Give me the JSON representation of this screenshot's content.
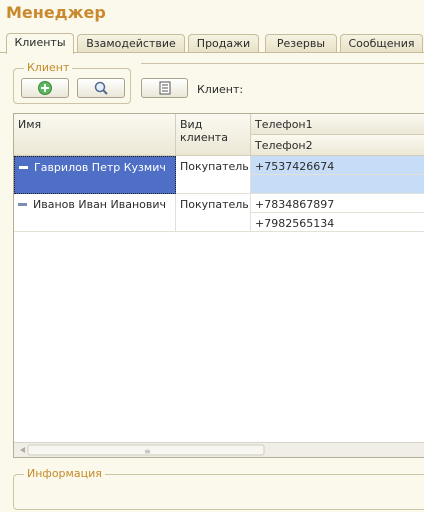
{
  "window": {
    "title": "Менеджер"
  },
  "tabs": [
    {
      "label": "Клиенты",
      "active": true
    },
    {
      "label": "Взамодействие"
    },
    {
      "label": "Продажи"
    },
    {
      "label": "Резервы"
    },
    {
      "label": "Сообщения"
    }
  ],
  "client_group": {
    "label": "Клиент"
  },
  "toolbar": {
    "client_label": "Клиент:"
  },
  "grid": {
    "headers": {
      "name": "Имя",
      "type": "Вид клиента",
      "phone1": "Телефон1",
      "phone2": "Телефон2"
    },
    "rows": [
      {
        "name": "Гаврилов Петр Кузмич",
        "type": "Покупатель",
        "phone1": "+7537426674",
        "phone2": "",
        "selected": true
      },
      {
        "name": "Иванов Иван Иванович",
        "type": "Покупатель",
        "phone1": "+7834867897",
        "phone2": "+7982565134"
      }
    ]
  },
  "info": {
    "label": "Информация"
  },
  "colors": {
    "title": "#c9892e",
    "group_label": "#c48b2a",
    "selection": "#4f6fc7",
    "selection_row": "#c6dcf7"
  }
}
